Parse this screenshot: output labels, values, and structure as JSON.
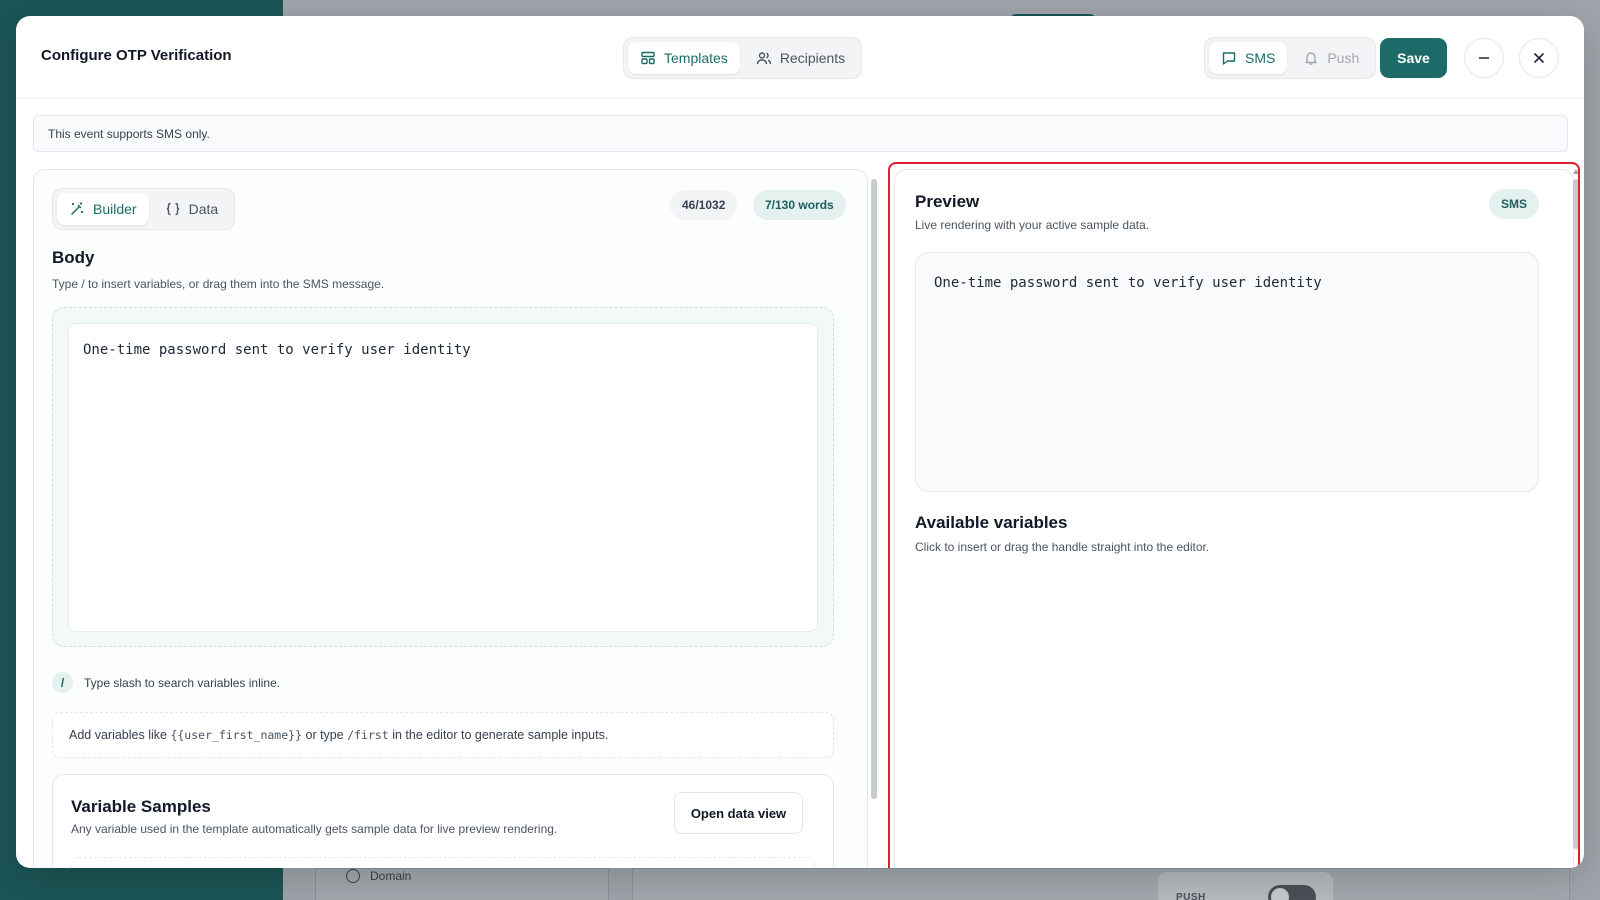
{
  "background": {
    "domain_label": "Domain",
    "push_label": "PUSH"
  },
  "modal": {
    "title": "Configure OTP Verification",
    "main_tabs": [
      {
        "label": "Templates",
        "icon": "layout-template-icon",
        "active": true
      },
      {
        "label": "Recipients",
        "icon": "users-icon",
        "active": false
      }
    ],
    "channels": [
      {
        "label": "SMS",
        "icon": "message-square-icon",
        "active": true
      },
      {
        "label": "Push",
        "icon": "bell-icon",
        "active": false
      }
    ],
    "save_label": "Save",
    "minimize_icon": "minus-icon",
    "close_icon": "close-icon",
    "notice": "This event supports SMS only."
  },
  "editor": {
    "modes": [
      {
        "label": "Builder",
        "icon": "wand-icon",
        "active": true
      },
      {
        "label": "Data",
        "icon": "braces-icon",
        "active": false
      }
    ],
    "char_count": "46/1032",
    "word_count": "7/130 words",
    "body_title": "Body",
    "body_subtitle": "Type / to insert variables, or drag them into the SMS message.",
    "body_text": "One-time password sent to verify user identity",
    "slash_symbol": "/",
    "slash_hint": "Type slash to search variables inline.",
    "hint": {
      "prefix": "Add variables like ",
      "code1": "{{user_first_name}}",
      "middle": " or type ",
      "code2": "/first",
      "suffix": " in the editor to generate sample inputs."
    },
    "samples": {
      "title": "Variable Samples",
      "subtitle": "Any variable used in the template automatically gets sample data for live preview rendering.",
      "open_button": "Open data view"
    }
  },
  "preview": {
    "title": "Preview",
    "subtitle": "Live rendering with your active sample data.",
    "badge": "SMS",
    "text": "One-time password sent to verify user identity",
    "variables_title": "Available variables",
    "variables_subtitle": "Click to insert or drag the handle straight into the editor."
  },
  "colors": {
    "accent": "#1c6b68",
    "accent_soft": "#e4f1ef",
    "highlight": "#e11d2e",
    "sidebar": "#1c5556"
  }
}
